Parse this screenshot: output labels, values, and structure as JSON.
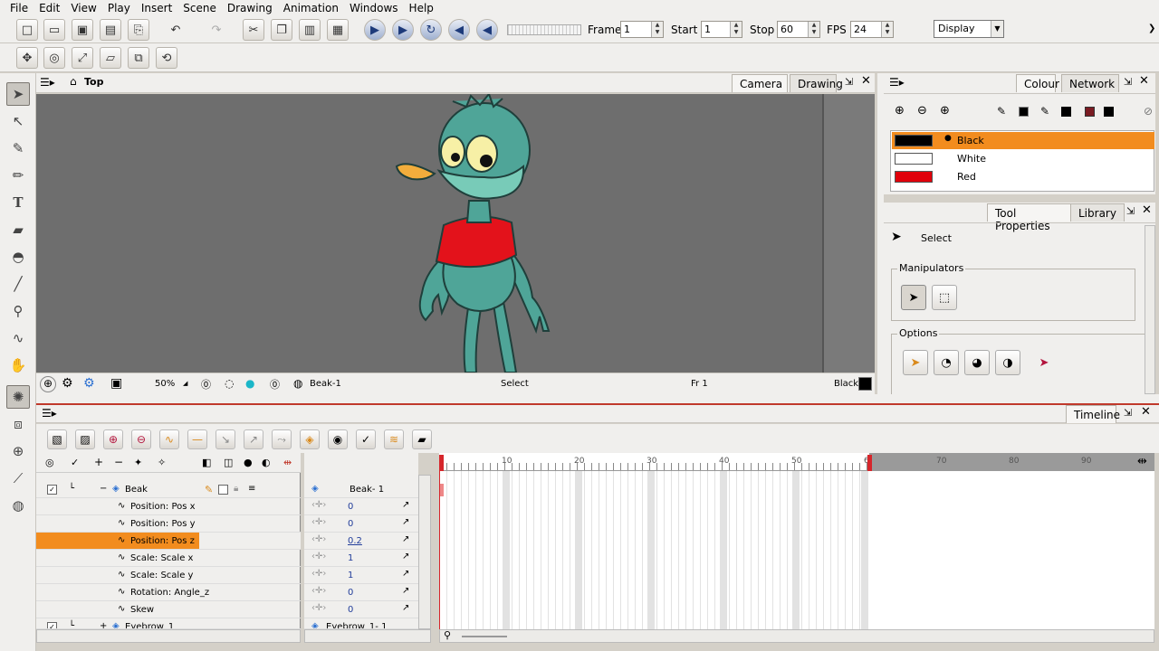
{
  "menu": [
    "File",
    "Edit",
    "View",
    "Play",
    "Insert",
    "Scene",
    "Drawing",
    "Animation",
    "Windows",
    "Help"
  ],
  "toolbar": {
    "frame_label": "Frame",
    "frame_value": "1",
    "start_label": "Start",
    "start_value": "1",
    "stop_label": "Stop",
    "stop_value": "60",
    "fps_label": "FPS",
    "fps_value": "24",
    "display_value": "Display"
  },
  "view": {
    "title": "Top",
    "tabs": [
      "Camera",
      "Drawing"
    ],
    "zoom": "50%",
    "drawing_name": "Beak-1",
    "tool": "Select",
    "frame": "Fr 1",
    "color": "Black"
  },
  "colour_panel": {
    "tabs": [
      "Colour",
      "Network"
    ],
    "swatches": [
      {
        "name": "Black",
        "color": "#000000",
        "selected": true
      },
      {
        "name": "White",
        "color": "#ffffff",
        "selected": false
      },
      {
        "name": "Red",
        "color": "#e0000b",
        "selected": false
      }
    ]
  },
  "tool_properties": {
    "tabs": [
      "Tool Properties",
      "Library"
    ],
    "tool_name": "Select",
    "manipulators_label": "Manipulators",
    "options_label": "Options"
  },
  "timeline": {
    "tab": "Timeline",
    "layers": [
      {
        "name": "Beak",
        "checked": true,
        "type": "drawing",
        "value": "Beak- 1"
      },
      {
        "name": "Position: Pos x",
        "value": "0"
      },
      {
        "name": "Position: Pos y",
        "value": "0"
      },
      {
        "name": "Position: Pos z",
        "value": "0.2",
        "selected": true
      },
      {
        "name": "Scale: Scale x",
        "value": "1"
      },
      {
        "name": "Scale: Scale y",
        "value": "1"
      },
      {
        "name": "Rotation: Angle_z",
        "value": "0"
      },
      {
        "name": "Skew",
        "value": "0"
      },
      {
        "name": "Eyebrow_1",
        "checked": true,
        "type": "drawing",
        "value": "Eyebrow_1- 1"
      }
    ],
    "ruler": [
      "10",
      "20",
      "30",
      "40",
      "50",
      "6",
      "70",
      "80",
      "90"
    ],
    "stop_frame": 60
  },
  "colors": {
    "accent": "#f28c1e",
    "marker": "#d6262b"
  }
}
